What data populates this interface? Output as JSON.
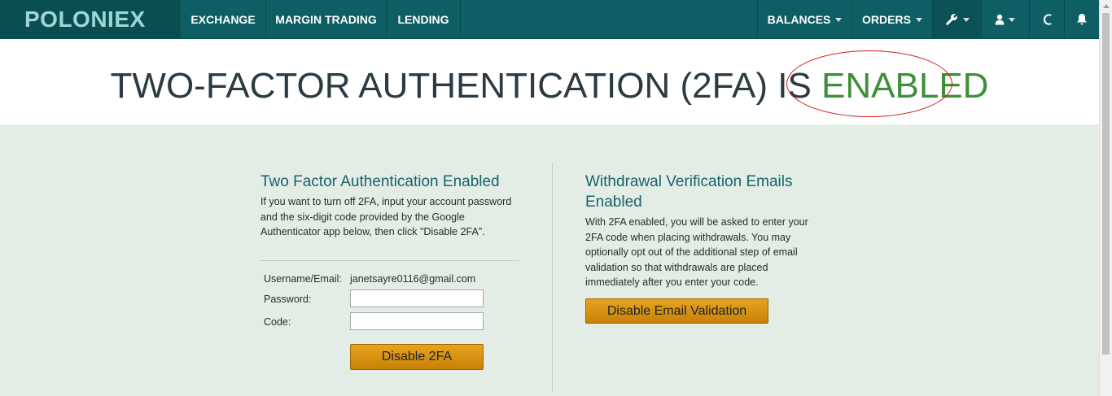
{
  "nav": {
    "logo": "POLONIEX",
    "items": [
      "EXCHANGE",
      "MARGIN TRADING",
      "LENDING"
    ],
    "right_items": [
      "BALANCES",
      "ORDERS"
    ],
    "icons": [
      "wrench-icon",
      "user-icon",
      "moon-icon",
      "bell-icon"
    ]
  },
  "hero": {
    "title_prefix": "TWO-FACTOR AUTHENTICATION (2FA) IS ",
    "title_status": "ENABLED",
    "status_color": "#3f8f3a",
    "annotation_color": "#d21b1b"
  },
  "left_panel": {
    "title": "Two Factor Authentication Enabled",
    "description": "If you want to turn off 2FA, input your account password and the six-digit code provided by the Google Authenticator app below, then click \"Disable 2FA\".",
    "username_label": "Username/Email:",
    "username_value": "janetsayre0116@gmail.com",
    "password_label": "Password:",
    "code_label": "Code:",
    "password_value": "",
    "code_value": "",
    "button": "Disable 2FA"
  },
  "right_panel": {
    "title": "Withdrawal Verification Emails Enabled",
    "description": "With 2FA enabled, you will be asked to enter your 2FA code when placing withdrawals. You may optionally opt out of the additional step of email validation so that withdrawals are placed immediately after you enter your code.",
    "button": "Disable Email Validation"
  },
  "colors": {
    "nav_bg": "#0e5f63",
    "logo_bg": "#0b4e52",
    "page_bg": "#e3ede5",
    "accent_button": "#d8930f",
    "title_teal": "#18636a"
  }
}
